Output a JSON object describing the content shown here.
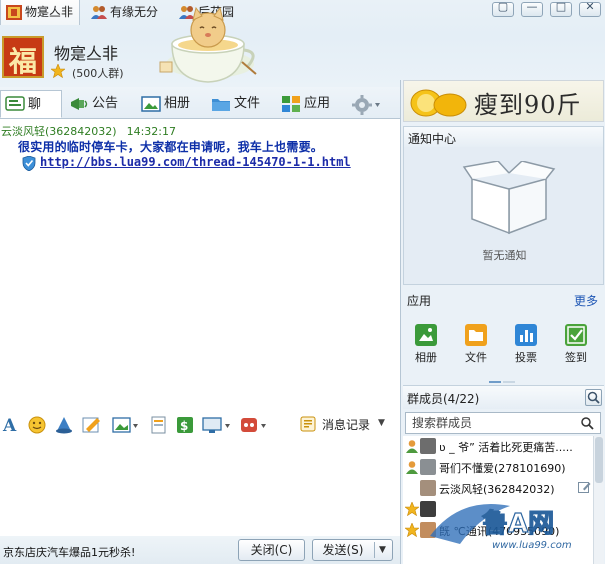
{
  "window_tabs": [
    {
      "label": "物寔亼非",
      "active": true
    },
    {
      "label": "有缘无分",
      "active": false
    },
    {
      "label": "后花园",
      "active": false
    }
  ],
  "group": {
    "name": "物寔亼非",
    "size": "(500人群)",
    "logo_char": "福"
  },
  "func_tabs": [
    {
      "label": "聊天",
      "icon": "chat-icon",
      "active": true
    },
    {
      "label": "公告",
      "icon": "megaphone-icon",
      "active": false
    },
    {
      "label": "相册",
      "icon": "photo-album-icon",
      "active": false
    },
    {
      "label": "文件",
      "icon": "folder-icon",
      "active": false
    },
    {
      "label": "应用",
      "icon": "apps-icon",
      "active": false
    }
  ],
  "message": {
    "sender": "云淡风轻(362842032)",
    "time": "14:32:17",
    "text": "很实用的临时停车卡，大家都在申请呢，我车上也需要。",
    "link": "http://bbs.lua99.com/thread-145470-1-1.html"
  },
  "toolbar": {
    "history_label": "消息记录"
  },
  "bottom": {
    "ad_text": "京东店庆汽车爆品1元秒杀!",
    "close_label": "关闭(C)",
    "send_label": "发送(S)"
  },
  "banner": {
    "text": "瘦到90斤"
  },
  "notice": {
    "title": "通知中心",
    "empty_text": "暂无通知"
  },
  "apps": {
    "title": "应用",
    "more": "更多",
    "items": [
      {
        "label": "相册",
        "icon": "photo-app-icon",
        "color": "#3b9a3a"
      },
      {
        "label": "文件",
        "icon": "file-app-icon",
        "color": "#f0a11c"
      },
      {
        "label": "投票",
        "icon": "vote-app-icon",
        "color": "#2f86d6"
      },
      {
        "label": "签到",
        "icon": "checkin-app-icon",
        "color": "#4aa33b"
      }
    ]
  },
  "members": {
    "title": "群成员(4/22)",
    "search_placeholder": "搜索群成员",
    "list": [
      {
        "name": "ʋ _ 爷” 活着比死更痛苦.....",
        "badge": "member"
      },
      {
        "name": "哥们不懂爱(278101690)",
        "badge": "member"
      },
      {
        "name": "云淡风轻(362842032)",
        "badge": "none"
      },
      {
        "name": "",
        "badge": "admin"
      },
      {
        "name": "旣 ℃通讯(470935090)",
        "badge": "admin"
      }
    ]
  },
  "watermark": {
    "text": "鲁A网",
    "url": "www.lua99.com"
  },
  "colors": {
    "accent": "#1f57b5",
    "message_text": "#0d2fa8",
    "sender": "#2f7d22",
    "panel_bg": "#eaf1f7"
  }
}
